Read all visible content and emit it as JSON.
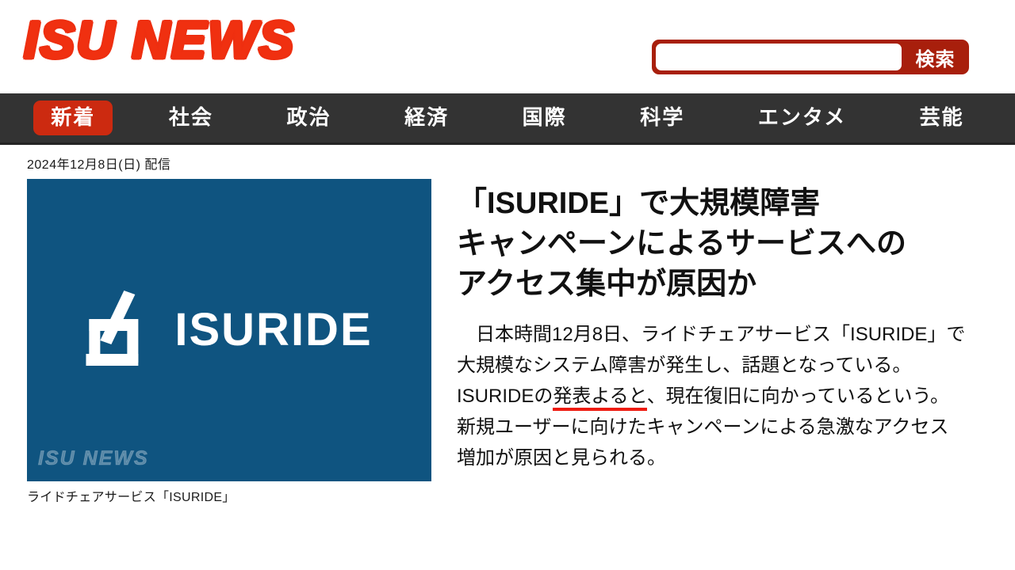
{
  "site": {
    "logo_text": "ISU NEWS",
    "logo_color": "#f03010"
  },
  "search": {
    "value": "",
    "placeholder": "",
    "submit_label": "検索",
    "bar_color": "#a81f0c"
  },
  "nav": {
    "bar_color": "#333333",
    "active_color": "#cc2a10",
    "items": [
      {
        "label": "新着",
        "active": true
      },
      {
        "label": "社会",
        "active": false
      },
      {
        "label": "政治",
        "active": false
      },
      {
        "label": "経済",
        "active": false
      },
      {
        "label": "国際",
        "active": false
      },
      {
        "label": "科学",
        "active": false
      },
      {
        "label": "エンタメ",
        "active": false
      },
      {
        "label": "芸能",
        "active": false
      }
    ]
  },
  "article": {
    "date": "2024年12月8日(日) 配信",
    "headline_lines": [
      "「ISURIDE」で大規模障害",
      "キャンペーンによるサービスへの",
      "アクセス集中が原因か"
    ],
    "body_lines": [
      {
        "pre": "　日本時間12月8日、ライドチェアサービス「ISURIDE」で",
        "underline": "",
        "post": ""
      },
      {
        "pre": "大規模なシステム障害が発生し、話題となっている。",
        "underline": "",
        "post": ""
      },
      {
        "pre": "ISURIDEの",
        "underline": "発表よると",
        "post": "、現在復旧に向かっているという。"
      },
      {
        "pre": "新規ユーザーに向けたキャンペーンによる急激なアクセス",
        "underline": "",
        "post": ""
      },
      {
        "pre": "増加が原因と見られる。",
        "underline": "",
        "post": ""
      }
    ],
    "underline_color": "#ee1c11",
    "figure": {
      "caption": "ライドチェアサービス「ISURIDE」",
      "background_color": "#0f5480",
      "brand_text": "ISURIDE",
      "brand_mark_name": "chair-logo-mark",
      "watermark_text": "ISU NEWS"
    }
  }
}
